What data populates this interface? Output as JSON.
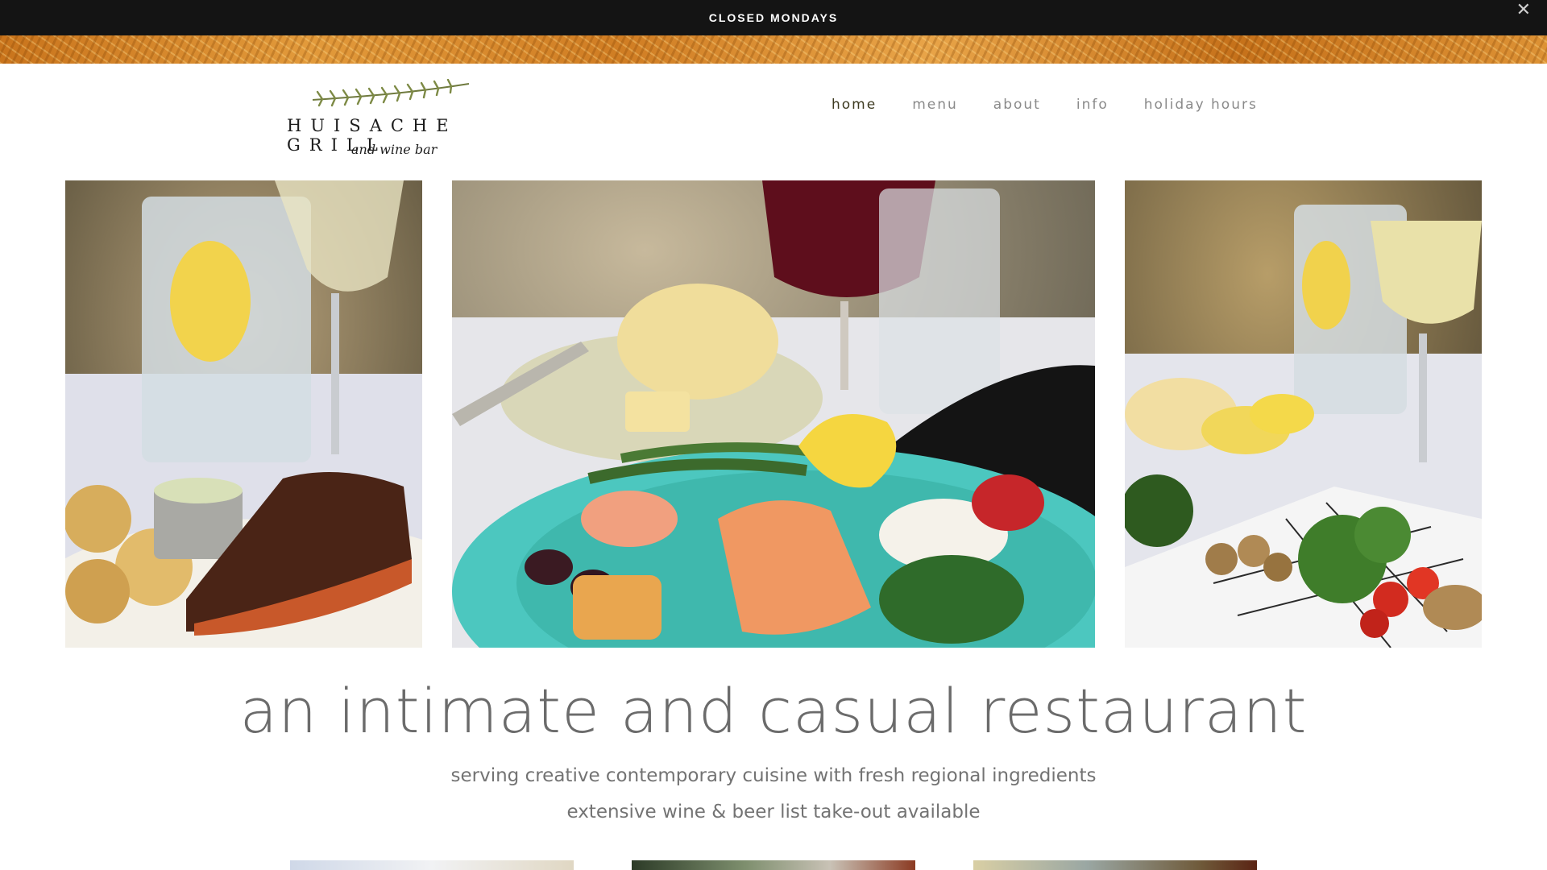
{
  "announcement": {
    "text": "CLOSED MONDAYS",
    "close_icon": "close-icon"
  },
  "brand": {
    "name": "HUISACHE GRILL",
    "tagline": "and wine bar",
    "logo_icon": "rosemary-sprig-icon"
  },
  "nav": {
    "items": [
      {
        "label": "home",
        "active": true
      },
      {
        "label": "menu",
        "active": false
      },
      {
        "label": "about",
        "active": false
      },
      {
        "label": "info",
        "active": false
      },
      {
        "label": "holiday hours",
        "active": false
      }
    ]
  },
  "hero": {
    "images": [
      {
        "subject": "blackened salmon with potatoes, water and white wine"
      },
      {
        "subject": "grilled salmon plate with shrimp, green beans, lemon, red wine"
      },
      {
        "subject": "vegetable plate with broccoli, mushrooms, tomatoes, white wine"
      }
    ]
  },
  "intro": {
    "headline": "an intimate and casual restaurant",
    "line1": "serving creative contemporary cuisine with fresh regional ingredients",
    "line2": "extensive wine & beer list take-out available"
  },
  "colors": {
    "announce_bg": "#141414",
    "nav_active": "#3d3a20",
    "nav_inactive": "#8a8a8a",
    "headline": "#6b6b6b"
  }
}
